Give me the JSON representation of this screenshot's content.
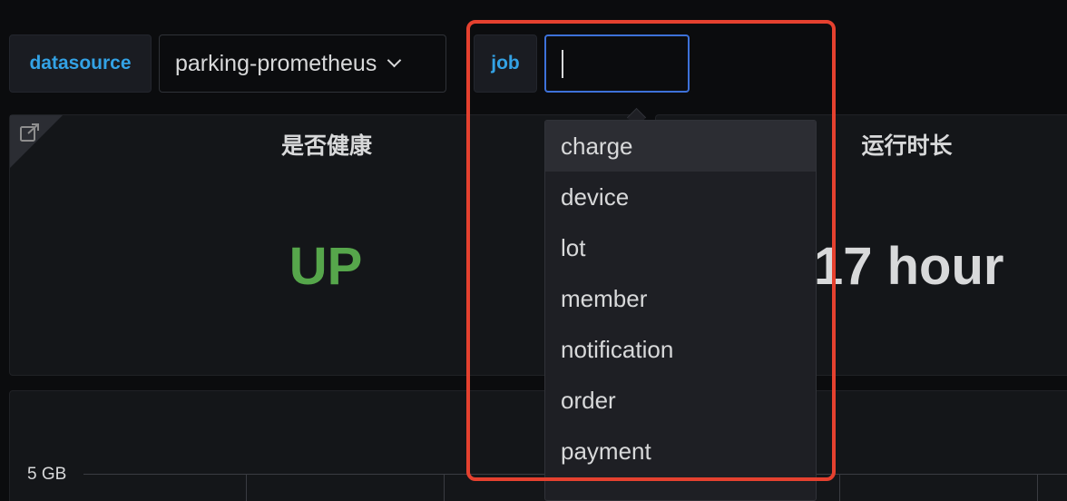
{
  "variables": {
    "datasource_label": "datasource",
    "datasource_value": "parking-prometheus",
    "job_label": "job",
    "job_input_value": ""
  },
  "panels": {
    "health": {
      "title": "是否健康",
      "value": "UP",
      "value_color": "#56a64b"
    },
    "uptime": {
      "title": "运行时长",
      "value": "17 hour"
    },
    "graph": {
      "y_tick": "5 GB"
    }
  },
  "job_dropdown": {
    "options": [
      "charge",
      "device",
      "lot",
      "member",
      "notification",
      "order",
      "payment"
    ],
    "active": "charge"
  },
  "icons": {
    "panel_link": "external-link-icon",
    "select_caret": "chevron-down-icon"
  },
  "colors": {
    "accent": "#33a2e5",
    "focus_border": "#3d71d9",
    "highlight": "#e5412f"
  }
}
